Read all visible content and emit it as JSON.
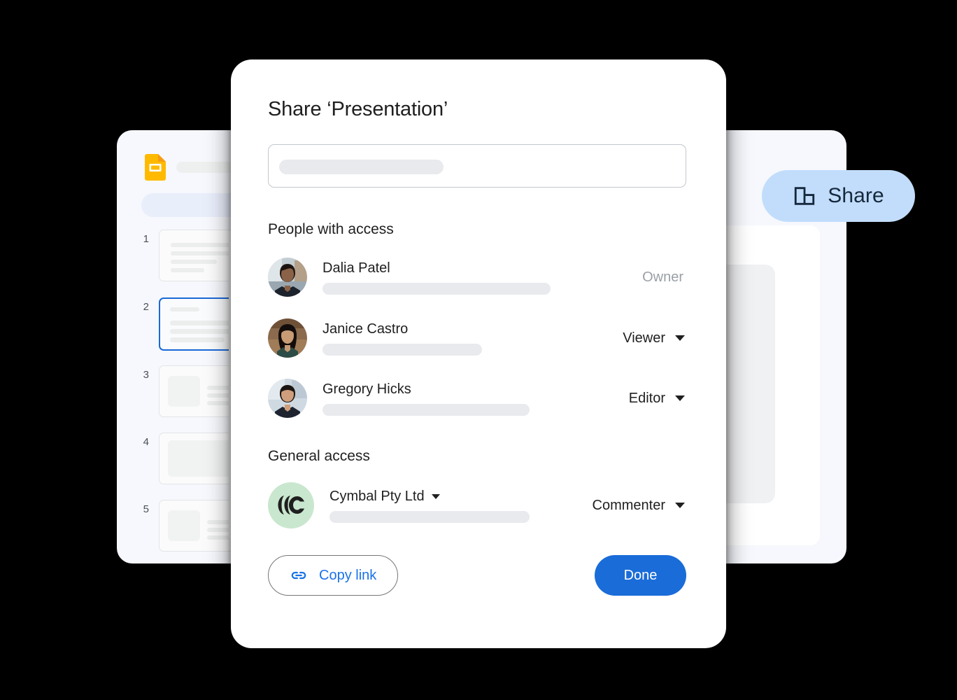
{
  "background_app": {
    "app_icon": "google-slides-icon",
    "slides": [
      {
        "number": "1",
        "selected": false,
        "layout": "text"
      },
      {
        "number": "2",
        "selected": true,
        "layout": "text-circle"
      },
      {
        "number": "3",
        "selected": false,
        "layout": "image-text"
      },
      {
        "number": "4",
        "selected": false,
        "layout": "full-block"
      },
      {
        "number": "5",
        "selected": false,
        "layout": "image-text"
      }
    ]
  },
  "share_pill": {
    "label": "Share",
    "icon": "domain-building-icon",
    "background_color": "#c2ddfb",
    "text_color": "#16293d"
  },
  "modal": {
    "title": "Share ‘Presentation’",
    "invite_input": {
      "value": "",
      "placeholder": ""
    },
    "people_section": {
      "heading": "People with access",
      "people": [
        {
          "name": "Dalia Patel",
          "email": "",
          "role": "Owner",
          "has_dropdown": false,
          "avatar": "avatar-dalia-patel"
        },
        {
          "name": "Janice Castro",
          "email": "",
          "role": "Viewer",
          "has_dropdown": true,
          "avatar": "avatar-janice-castro"
        },
        {
          "name": "Gregory Hicks",
          "email": "",
          "role": "Editor",
          "has_dropdown": true,
          "avatar": "avatar-gregory-hicks"
        }
      ]
    },
    "general_section": {
      "heading": "General access",
      "org": {
        "name": "Cymbal Pty Ltd",
        "role": "Commenter",
        "avatar": "cymbal-logo-icon",
        "avatar_color": "#c9e7ce"
      }
    },
    "footer": {
      "copy_link_label": "Copy link",
      "copy_link_icon": "link-chain-icon",
      "done_label": "Done",
      "done_color": "#1a6cd8",
      "link_text_color": "#1a73e8"
    }
  }
}
